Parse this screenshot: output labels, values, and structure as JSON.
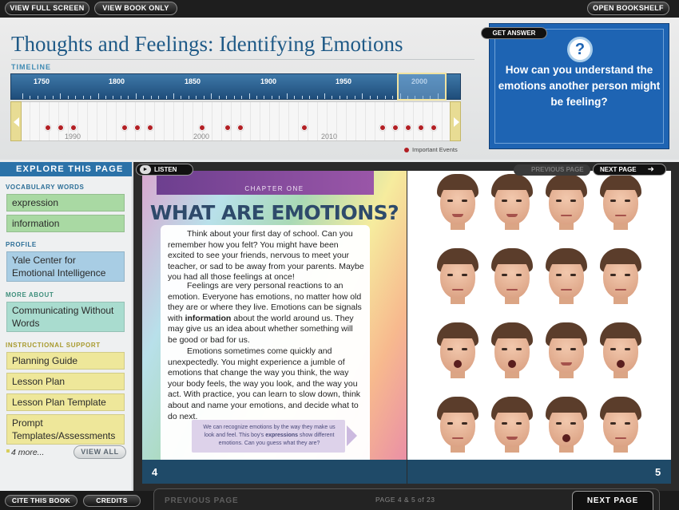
{
  "topbar": {
    "view_full_screen": "VIEW FULL SCREEN",
    "view_book_only": "VIEW BOOK ONLY",
    "open_bookshelf": "OPEN BOOKSHELF"
  },
  "page": {
    "title": "Thoughts and Feelings: Identifying Emotions"
  },
  "timeline": {
    "label": "TIMELINE",
    "years": [
      "1750",
      "1800",
      "1850",
      "1900",
      "1950",
      "2000"
    ],
    "decades": [
      "1990",
      "2000",
      "2010"
    ],
    "legend": "Important Events"
  },
  "question": {
    "get_answer": "GET ANSWER",
    "icon": "question-icon",
    "text": "How can you understand the emotions another person might be feeling?"
  },
  "sidebar": {
    "header": "EXPLORE THIS PAGE",
    "vocab_label": "VOCABULARY WORDS",
    "vocab": [
      "expression",
      "information"
    ],
    "profile_label": "PROFILE",
    "profile": "Yale Center for Emotional Intelligence",
    "more_about_label": "MORE ABOUT",
    "more_about": "Communicating Without Words",
    "instructional_label": "INSTRUCTIONAL SUPPORT",
    "instructional": [
      "Planning Guide",
      "Lesson Plan",
      "Lesson Plan Template",
      "Prompt Templates/Assessments"
    ],
    "more_link": "4 more...",
    "view_all": "VIEW ALL"
  },
  "book": {
    "listen": "LISTEN",
    "previous_page_top": "PREVIOUS PAGE",
    "next_page_top": "NEXT PAGE",
    "chapter_label": "CHAPTER ONE",
    "chapter_title": "WHAT ARE EMOTIONS?",
    "para1": "Think about your first day of school. Can you remember how you felt? You might have been excited to see your friends, nervous to meet your teacher, or sad to be away from your parents. Maybe you had all those feelings at once!",
    "para2_a": "Feelings are very personal reactions to an emotion. Everyone has emotions, no matter how old they are or where they live. Emotions can be signals with ",
    "para2_bold": "information",
    "para2_b": " about the world around us. They may give us an idea about whether something will be good or bad for us.",
    "para3": "Emotions sometimes come quickly and unexpectedly. You might experience a jumble of emotions that change the way you think, the way your body feels, the way you look, and the way you act. With practice, you can learn to slow down, think about and name your emotions, and decide what to do next.",
    "caption_a": "We can recognize emotions by the way they make us look and feel. This boy's ",
    "caption_bold": "expressions",
    "caption_b": " show different emotions. Can you guess what they are?",
    "left_page_number": "4",
    "right_page_number": "5"
  },
  "bottombar": {
    "cite": "CITE THIS BOOK",
    "credits": "CREDITS",
    "previous_page": "PREVIOUS PAGE",
    "page_of": "PAGE 4 & 5 of 23",
    "next_page": "NEXT PAGE"
  },
  "colors": {
    "title_blue": "#1f5a87",
    "timeline_blue": "#2b5e8e",
    "event_red": "#b21f24",
    "question_blue": "#1e64b3",
    "vocab_green": "#a9d9a3",
    "profile_blue": "#a8cde4",
    "more_about_teal": "#a9dccf",
    "instructional_yellow": "#eee79a"
  }
}
